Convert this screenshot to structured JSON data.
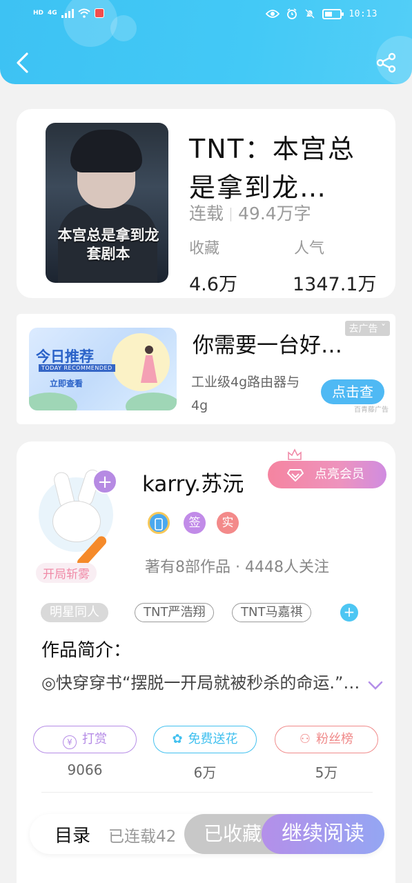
{
  "status_bar": {
    "net_hd": "HD",
    "net_4g": "4G",
    "time": "10:13"
  },
  "book": {
    "title": "TNT：本宫总是拿到龙…",
    "cover_text": "本宫总是拿到龙套剧本",
    "status": "连载",
    "word_count": "49.4万字",
    "favorites_label": "收藏",
    "favorites_value": "4.6万",
    "popularity_label": "人气",
    "popularity_value": "1347.1万"
  },
  "ad": {
    "image_title": "今日推荐",
    "image_subtitle": "TODAY RECOMMENDED",
    "image_cta": "立即查看",
    "title": "你需要一台好…",
    "tag": "去广告",
    "description": "工业级4g路由器与4g",
    "button": "点击查",
    "source": "百青藤广告"
  },
  "author": {
    "name": "karry.苏沅",
    "vip_button": "点亮会员",
    "avatar_label": "开局斩雾",
    "badges": [
      "签",
      "实"
    ],
    "stats": "著有8部作品 · 4448人关注",
    "tags": [
      "明星同人",
      "TNT严浩翔",
      "TNT马嘉祺"
    ],
    "intro_label": "作品简介：",
    "intro_text": "◎快穿穿书“摆脱一开局就被秒杀的命运.”…"
  },
  "actions": [
    {
      "label": "打赏",
      "count": "9066",
      "color": "#b58be6"
    },
    {
      "label": "免费送花",
      "count": "6万",
      "color": "#41c0ef"
    },
    {
      "label": "粉丝榜",
      "count": "5万",
      "color": "#f08a8a"
    }
  ],
  "bottom_bar": {
    "toc": "目录",
    "status": "已连载42",
    "favorited": "已收藏",
    "continue_read": "继续阅读"
  },
  "colors": {
    "header": "#43c9f6",
    "accent_purple": "#b48fe9",
    "accent_blue": "#4fb9f4",
    "vip_pink": "#f584a0"
  }
}
